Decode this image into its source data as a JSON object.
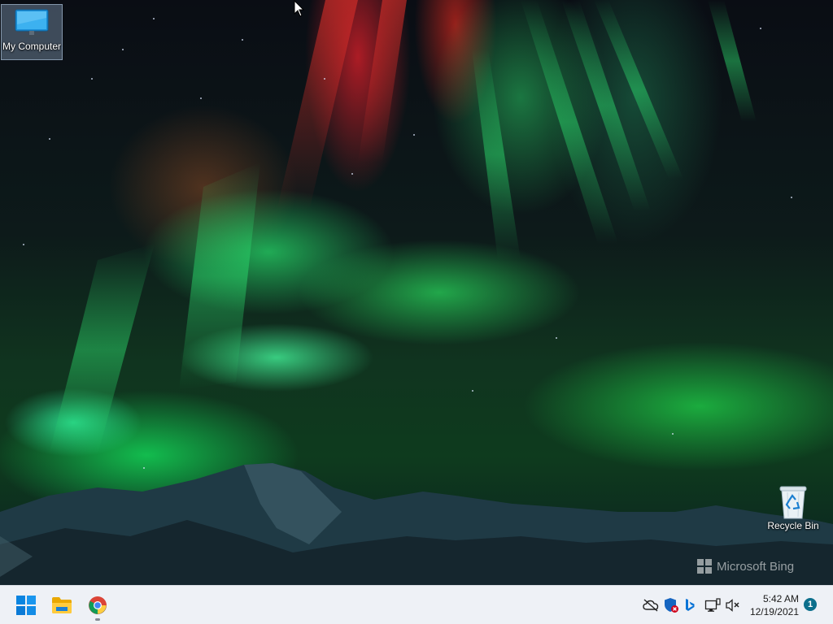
{
  "desktop": {
    "wallpaper": "Aurora borealis over mountains",
    "icons": [
      {
        "id": "my-computer",
        "label": "My Computer",
        "icon": "monitor-icon",
        "selected": true
      },
      {
        "id": "recycle-bin",
        "label": "Recycle Bin",
        "icon": "recycle-bin-icon",
        "selected": false
      }
    ],
    "watermark": "Microsoft Bing"
  },
  "taskbar": {
    "pinned": [
      {
        "id": "start",
        "icon": "windows-start-icon",
        "running": false
      },
      {
        "id": "file-explorer",
        "icon": "folder-icon",
        "running": false
      },
      {
        "id": "chrome",
        "icon": "chrome-icon",
        "running": true
      }
    ],
    "tray": [
      {
        "id": "onedrive",
        "icon": "cloud-offline-icon"
      },
      {
        "id": "defender",
        "icon": "shield-warning-icon"
      },
      {
        "id": "bing",
        "icon": "bing-icon"
      },
      {
        "id": "network",
        "icon": "network-icon"
      },
      {
        "id": "volume",
        "icon": "volume-muted-icon"
      }
    ],
    "clock": {
      "time": "5:42 AM",
      "date": "12/19/2021"
    },
    "notifications": {
      "count": "1"
    }
  },
  "colors": {
    "taskbar_bg": "#eef1f6",
    "accent": "#0078d4",
    "badge": "#0c6f8c"
  }
}
